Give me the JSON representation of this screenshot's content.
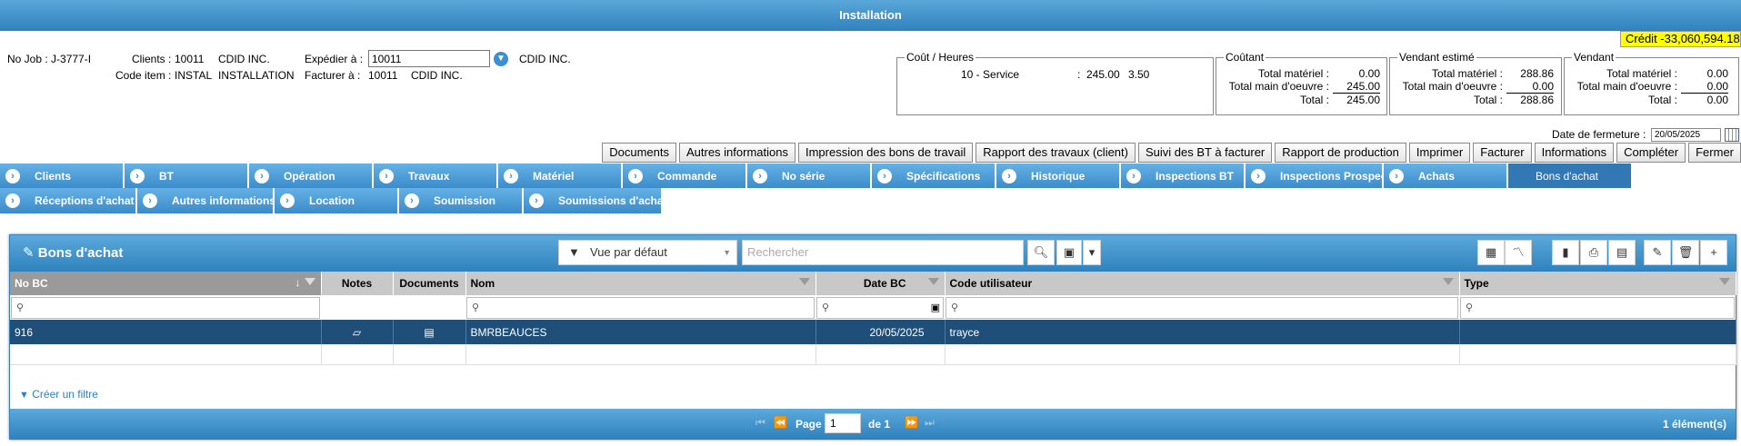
{
  "window": {
    "title": "Installation"
  },
  "credit": "Crédit -33,060,594.18",
  "job": {
    "no_job": "No Job : J-3777-I",
    "clients_label": "Clients :",
    "clients_value": "10011",
    "clients_name": "CDID INC.",
    "code_item_label": "Code item :",
    "code_item_value": "INSTAL",
    "code_item_name": "INSTALLATION",
    "expedier_label": "Expédier à :",
    "expedier_value": "10011",
    "expedier_name": "CDID INC.",
    "facturer_label": "Facturer à :",
    "facturer_value": "10011",
    "facturer_name": "CDID INC."
  },
  "cout_heures": {
    "legend": "Coût / Heures",
    "line_label": "10 - Service",
    "line_sep": ":",
    "line_amount": "245.00",
    "line_hours": "3.50"
  },
  "coutant": {
    "legend": "Coûtant",
    "materiel_label": "Total matériel :",
    "materiel": "0.00",
    "main_label": "Total main d'oeuvre :",
    "main": "245.00",
    "total_label": "Total :",
    "total": "245.00"
  },
  "vendant_estime": {
    "legend": "Vendant estimé",
    "materiel_label": "Total matériel :",
    "materiel": "288.86",
    "main_label": "Total main d'oeuvre :",
    "main": "0.00",
    "total_label": "Total :",
    "total": "288.86"
  },
  "vendant": {
    "legend": "Vendant",
    "materiel_label": "Total matériel :",
    "materiel": "0.00",
    "main_label": "Total main d'oeuvre :",
    "main": "0.00",
    "total_label": "Total :",
    "total": "0.00"
  },
  "date_fermeture": {
    "label": "Date de fermeture :",
    "value": "20/05/2025"
  },
  "action_buttons": [
    "Documents",
    "Autres informations",
    "Impression des bons de travail",
    "Rapport des travaux (client)",
    "Suivi des BT à facturer",
    "Rapport de production",
    "Imprimer",
    "Facturer",
    "Informations",
    "Compléter",
    "Fermer"
  ],
  "tabs_row1": [
    "Clients",
    "BT",
    "Opération",
    "Travaux",
    "Matériel",
    "Commande",
    "No série",
    "Spécifications",
    "Historique",
    "Inspections BT",
    "Inspections Prospect",
    "Achats",
    "Bons d'achat"
  ],
  "tabs_row2": [
    "Réceptions d'achat",
    "Autres informations",
    "Location",
    "Soumission",
    "Soumissions d'achat"
  ],
  "grid": {
    "title": "Bons d'achat",
    "view_select": "Vue par défaut",
    "search_placeholder": "Rechercher",
    "columns": [
      "No BC",
      "Notes",
      "Documents",
      "Nom",
      "Date BC",
      "Code utilisateur",
      "Type"
    ],
    "rows": [
      {
        "no_bc": "916",
        "nom": "BMRBEAUCES",
        "date_bc": "20/05/2025",
        "code_utilisateur": "trayce",
        "type": ""
      }
    ],
    "create_filter": "Créer un filtre",
    "page_label": "Page",
    "page_value": "1",
    "page_of": "de 1",
    "count": "1 élément(s)"
  },
  "colors": {
    "header_blue": "#2f82bd",
    "tab_blue": "#3a8bc9",
    "selected_row": "#1f4e79",
    "credit_bg": "#ffff00"
  }
}
